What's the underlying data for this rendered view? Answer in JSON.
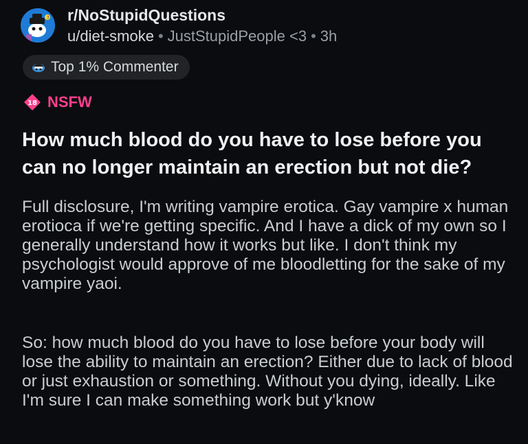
{
  "post": {
    "subreddit": "r/NoStupidQuestions",
    "author": "u/diet-smoke",
    "flair": "JustStupidPeople <3",
    "separator": "•",
    "age": "3h",
    "badge": {
      "label": "Top 1% Commenter",
      "icon": "commenter-badge-icon"
    },
    "nsfw": {
      "age_label": "18",
      "label": "NSFW",
      "color": "#ff3f8c"
    },
    "title": "How much blood do you have to lose before you can no longer maintain an erection but not die?",
    "body": [
      "Full disclosure, I'm writing vampire erotica. Gay vampire x human erotioca if we're getting specific. And I have a dick of my own so I generally understand how it works but like. I don't think my psychologist would approve of me bloodletting for the sake of my vampire yaoi.",
      "So: how much blood do you have to lose before your body will lose the ability to maintain an erection? Either due to lack of blood or just exhaustion or something. Without you dying, ideally. Like I'm sure I can make something work but y'know"
    ]
  },
  "colors": {
    "background": "#0b0c0f",
    "avatar": "#1e7bd6",
    "nsfw": "#ff3f8c",
    "badge_bg": "#212327"
  }
}
